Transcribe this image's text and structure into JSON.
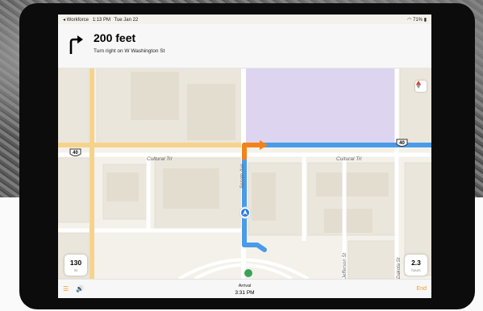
{
  "status_bar": {
    "carrier": "◂ Workforce",
    "time": "1:13 PM",
    "date": "Tue Jan 22",
    "battery": "71%"
  },
  "navigation": {
    "distance": "200 feet",
    "instruction": "Turn right on W Washington St",
    "maneuver_icon": "turn-right-arrow-icon"
  },
  "map": {
    "highway_shields": [
      "40",
      "40"
    ],
    "road_labels": {
      "cultural_trail_left": "Cultural Trl",
      "cultural_trail_right": "Cultural Trl",
      "vertical_left": "Senate Ave",
      "vertical_mid": "Jefferson St",
      "vertical_right": "Dakota St"
    },
    "colors": {
      "route": "#4a9be8",
      "next_turn": "#f2831b",
      "arterial": "#f6d38c",
      "highlight_block": "#ddd5ef",
      "background": "#f4f1ea"
    }
  },
  "speed_pill": {
    "value": "130",
    "unit": "mi"
  },
  "time_pill": {
    "value": "2.3",
    "unit": "hours"
  },
  "bottom_bar": {
    "arrival_label": "Arrival",
    "arrival_time": "3:31 PM",
    "end_label": "End"
  }
}
